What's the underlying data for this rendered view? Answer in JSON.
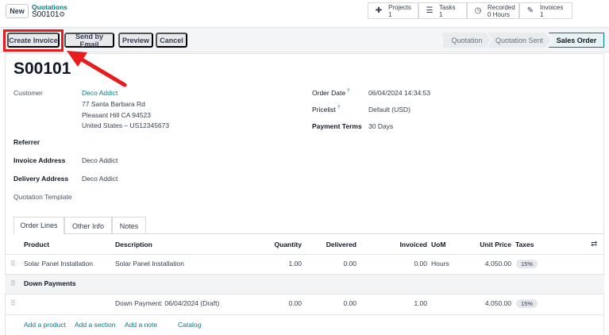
{
  "topbar": {
    "new_label": "New",
    "breadcrumb_parent": "Quotations",
    "record_name": "S00101",
    "smart_buttons": [
      {
        "icon": "puzzle-icon",
        "label": "Projects",
        "value": "1"
      },
      {
        "icon": "tasks-icon",
        "label": "Tasks",
        "value": "1"
      },
      {
        "icon": "clock-icon",
        "label": "Recorded",
        "value": "0 Hours"
      },
      {
        "icon": "invoice-icon",
        "label": "Invoices",
        "value": "1"
      }
    ]
  },
  "actions": {
    "create_invoice": "Create Invoice",
    "send_by_email": "Send by Email",
    "preview": "Preview",
    "cancel": "Cancel"
  },
  "status": {
    "steps": [
      "Quotation",
      "Quotation Sent",
      "Sales Order"
    ],
    "current": "Sales Order"
  },
  "form": {
    "title": "S00101",
    "customer_label": "Customer",
    "customer_name": "Deco Addict",
    "customer_address_1": "77 Santa Barbara Rd",
    "customer_address_2": "Pleasant Hill CA 94523",
    "customer_address_3": "United States – US12345673",
    "referrer_label": "Referrer",
    "invoice_address_label": "Invoice Address",
    "invoice_address": "Deco Addict",
    "delivery_address_label": "Delivery Address",
    "delivery_address": "Deco Addict",
    "quotation_template_label": "Quotation Template",
    "order_date_label": "Order Date",
    "order_date": "06/04/2024 14:34:53",
    "pricelist_label": "Pricelist",
    "pricelist": "Default (USD)",
    "payment_terms_label": "Payment Terms",
    "payment_terms": "30 Days",
    "help_mark": "?"
  },
  "tabs": [
    "Order Lines",
    "Other Info",
    "Notes"
  ],
  "table": {
    "headers": {
      "product": "Product",
      "description": "Description",
      "quantity": "Quantity",
      "delivered": "Delivered",
      "invoiced": "Invoiced",
      "uom": "UoM",
      "unit_price": "Unit Price",
      "taxes": "Taxes"
    },
    "row1": {
      "product": "Solar Panel Installation",
      "description": "Solar Panel Installation",
      "quantity": "1.00",
      "delivered": "0.00",
      "invoiced": "0.00",
      "uom": "Hours",
      "unit_price": "4,050.00",
      "taxes": "15%"
    },
    "section": "Down Payments",
    "row2": {
      "description": "Down Payment: 06/04/2024 (Draft)",
      "quantity": "0.00",
      "delivered": "0.00",
      "invoiced": "1.00",
      "unit_price": "4,050.00",
      "taxes": "15%"
    },
    "add_links": {
      "add_product": "Add a product",
      "add_section": "Add a section",
      "add_note": "Add a note",
      "catalog": "Catalog"
    }
  },
  "colors": {
    "accent": "#017e84",
    "highlight": "#e81c1c"
  }
}
